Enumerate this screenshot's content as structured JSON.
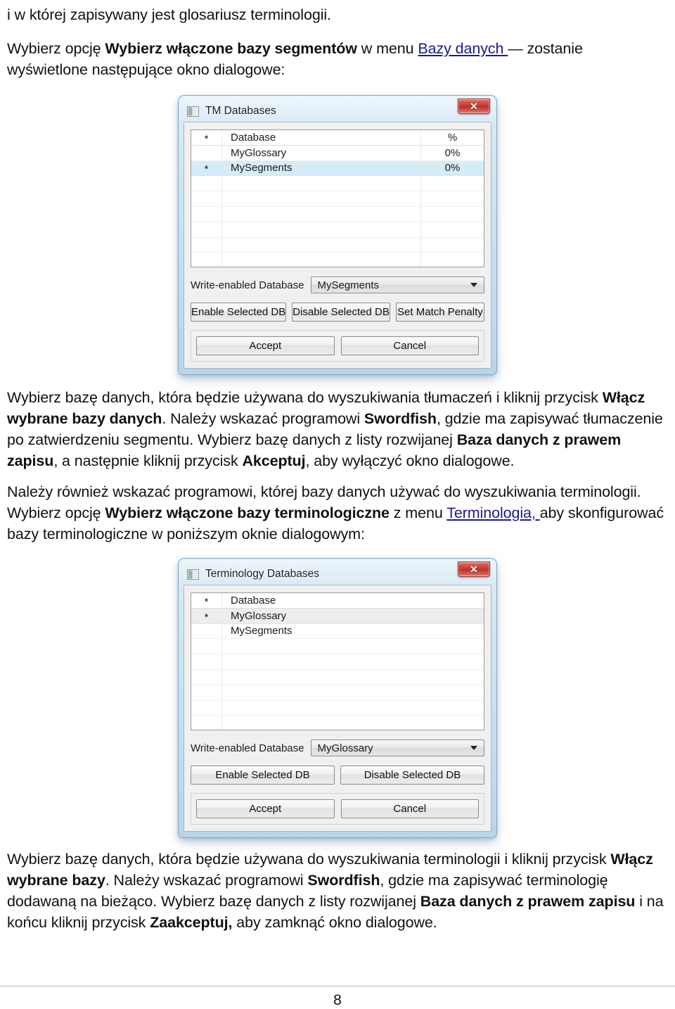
{
  "document": {
    "page_number": "8",
    "paragraphs": {
      "p1": "i w której zapisywany jest glosariusz terminologii.",
      "p2_pre": "Wybierz opcję ",
      "p2_bold": "Wybierz włączone bazy segmentów",
      "p2_mid": " w menu ",
      "p2_link": "Bazy danych ",
      "p2_post": "— zostanie wyświetlone następujące okno dialogowe:",
      "p3_a": "Wybierz bazę danych, która będzie używana do wyszukiwania tłumaczeń i kliknij przycisk ",
      "p3_b1": "Włącz wybrane bazy danych",
      "p3_b": ". Należy wskazać programowi ",
      "p3_b2": "Swordfish",
      "p3_c": ", gdzie ma zapisywać tłumaczenie po zatwierdzeniu segmentu. Wybierz bazę danych z listy rozwijanej ",
      "p3_b3": "Baza danych z prawem zapisu",
      "p3_d": ", a następnie kliknij przycisk ",
      "p3_b4": "Akceptuj",
      "p3_e": ", aby wyłączyć okno dialogowe.",
      "p4_a": "Należy również wskazać programowi, której bazy danych używać do wyszukiwania terminologii. Wybierz opcję ",
      "p4_b1": "Wybierz włączone bazy terminologiczne",
      "p4_b": " z menu ",
      "p4_link": "Terminologia, ",
      "p4_c": "aby skonfigurować bazy terminologiczne w poniższym oknie dialogowym:",
      "p5_a": "Wybierz bazę danych, która będzie używana do wyszukiwania terminologii i kliknij przycisk ",
      "p5_b1": "Włącz wybrane bazy",
      "p5_b": ". Należy wskazać programowi ",
      "p5_b2": "Swordfish",
      "p5_c": ", gdzie ma zapisywać terminologię dodawaną na bieżąco. Wybierz bazę danych z listy rozwijanej ",
      "p5_b3": "Baza danych z prawem zapisu",
      "p5_d": " i na końcu kliknij przycisk ",
      "p5_b4": "Zaakceptuj,",
      "p5_e": " aby zamknąć okno dialogowe."
    }
  },
  "dialog_tm": {
    "title": "TM Databases",
    "close_label": "✕",
    "table": {
      "columns": [
        "*",
        "Database",
        "%"
      ],
      "header": {
        "star": "*",
        "name": "Database",
        "pct": "%"
      },
      "rows": [
        {
          "star": "",
          "name": "MyGlossary",
          "pct": "0%",
          "state": "normal"
        },
        {
          "star": "*",
          "name": "MySegments",
          "pct": "0%",
          "state": "selected-blue"
        }
      ],
      "empty_row_count": 7
    },
    "combo": {
      "label": "Write-enabled Database",
      "value": "MySegments"
    },
    "buttons": {
      "enable": "Enable Selected DB",
      "disable": "Disable Selected DB",
      "penalty": "Set Match Penalty",
      "accept": "Accept",
      "cancel": "Cancel"
    }
  },
  "dialog_term": {
    "title": "Terminology Databases",
    "close_label": "✕",
    "table": {
      "columns": [
        "*",
        "Database"
      ],
      "header": {
        "star": "*",
        "name": "Database"
      },
      "rows": [
        {
          "star": "*",
          "name": "MyGlossary",
          "state": "selected-gray"
        },
        {
          "star": "",
          "name": "MySegments",
          "state": "normal"
        }
      ],
      "empty_row_count": 7
    },
    "combo": {
      "label": "Write-enabled Database",
      "value": "MyGlossary"
    },
    "buttons": {
      "enable": "Enable Selected DB",
      "disable": "Disable Selected DB",
      "accept": "Accept",
      "cancel": "Cancel"
    }
  },
  "colors": {
    "selection_blue": "#d6ecf7",
    "selection_gray": "#ededed",
    "close_red": "#c03a31",
    "link_blue": "#1a1a8c",
    "aero_frame": "#cde4f4"
  }
}
